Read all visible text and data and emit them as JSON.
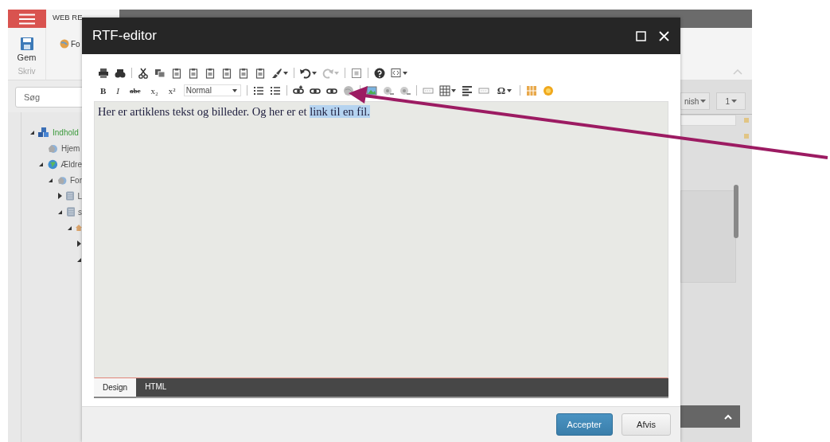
{
  "background_app": {
    "menu_tab_label": "WEB RE",
    "ribbon": {
      "partial_label": "Fo",
      "save_label": "Gem",
      "group_label": "Skriv"
    },
    "search": {
      "placeholder": "Søg"
    },
    "tree": [
      {
        "label": "Indhold",
        "kind": "root",
        "expanded": true,
        "children": [
          {
            "label": "Hjem",
            "kind": "page"
          },
          {
            "label": "Ældre",
            "kind": "site",
            "expanded": true,
            "children": [
              {
                "label": "For",
                "kind": "page",
                "expanded": true,
                "children": [
                  {
                    "label": "L",
                    "kind": "folder",
                    "expanded": false
                  },
                  {
                    "label": "s",
                    "kind": "folder",
                    "expanded": true,
                    "children": [
                      {
                        "kind": "house",
                        "expanded": true,
                        "children": [
                          {
                            "expanded": false
                          },
                          {
                            "expanded": true
                          }
                        ]
                      }
                    ]
                  }
                ]
              }
            ]
          }
        ]
      }
    ],
    "right_buttons": [
      "nish",
      "1"
    ]
  },
  "dialog": {
    "title": "RTF-editor",
    "toolbar": {
      "format_buttons": [
        "B",
        "I",
        "abc",
        "x₂",
        "x²"
      ],
      "style_select": "Normal",
      "special_char": "Ω",
      "redo_disabled": true
    },
    "content": {
      "text": "Her er artiklens tekst og billeder. Og her er et ",
      "selected_text": "link til en fil."
    },
    "view_tabs": [
      {
        "label": "Design",
        "selected": true
      },
      {
        "label": "HTML",
        "selected": false
      }
    ],
    "buttons": [
      {
        "label": "Accepter",
        "kind": "primary"
      },
      {
        "label": "Afvis",
        "kind": "secondary"
      }
    ]
  }
}
